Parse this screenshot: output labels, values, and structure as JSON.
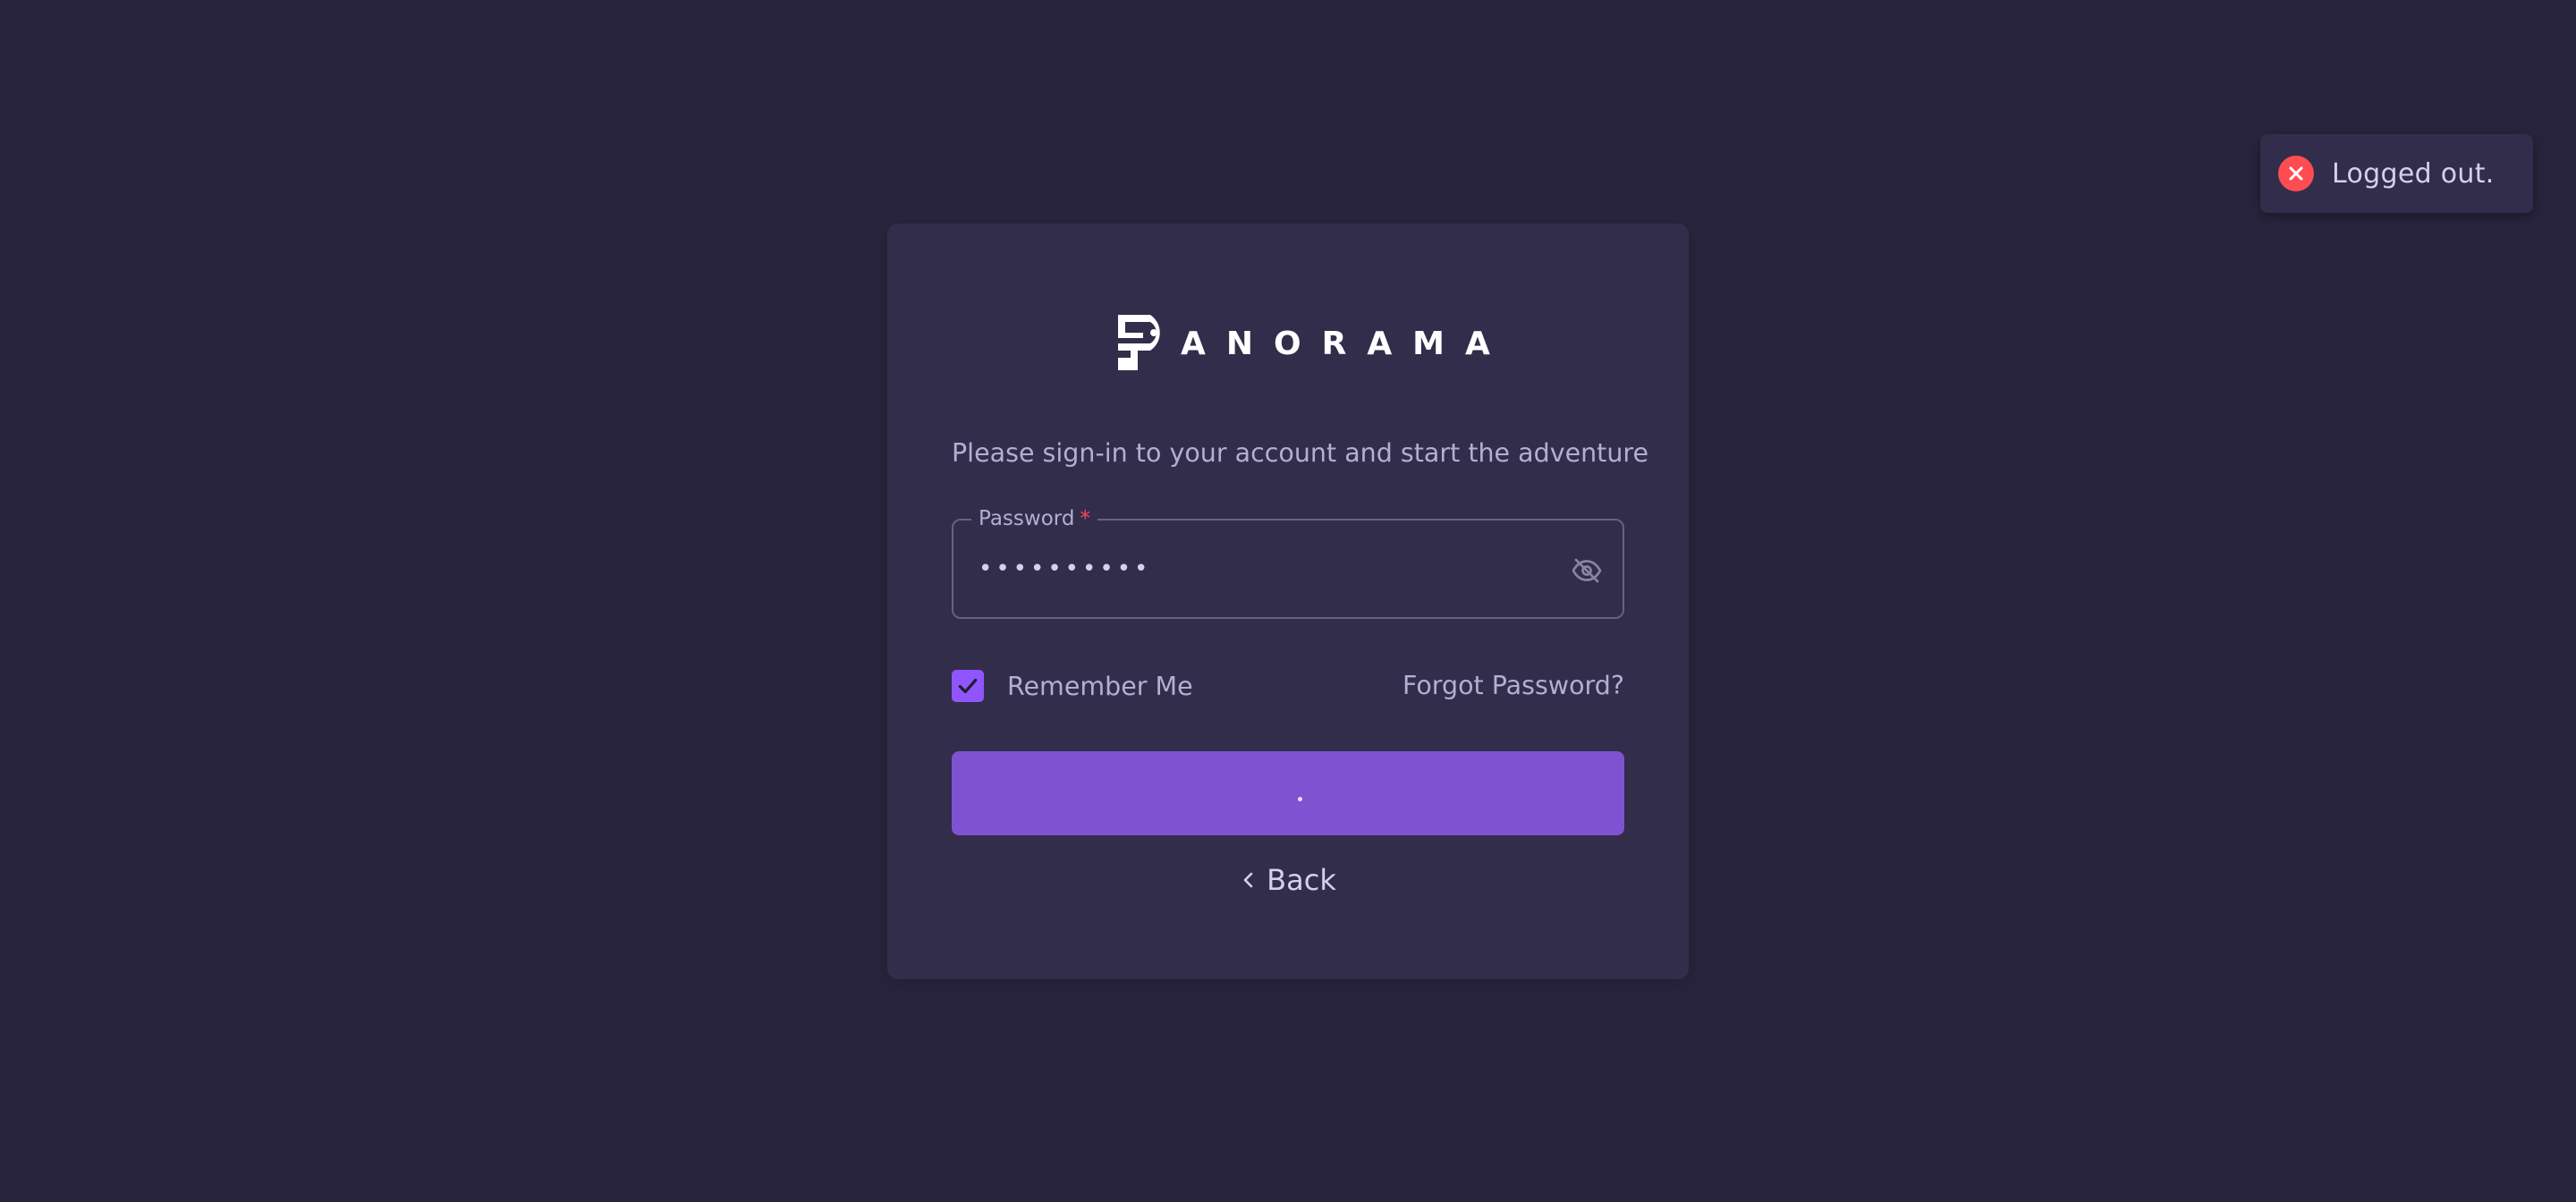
{
  "toast": {
    "message": "Logged out.",
    "icon": "close-circle-icon",
    "color": "#ff4c51"
  },
  "brand": {
    "logo_icon": "panorama-p-logo-icon",
    "wordmark": "ANORAMA"
  },
  "login": {
    "tagline": "Please sign-in to your account and start the adventure",
    "password": {
      "label": "Password",
      "required_marker": "*",
      "value": "••••••••••",
      "toggle_icon": "eye-off-icon"
    },
    "remember_me": {
      "label": "Remember Me",
      "checked": true
    },
    "forgot_password": "Forgot Password?",
    "submit": {
      "state": "loading",
      "color": "#7e52d1"
    },
    "back": {
      "label": "Back",
      "icon": "chevron-left-icon"
    }
  },
  "colors": {
    "background": "#28243d",
    "card": "#312d4b",
    "accent": "#9155fd"
  }
}
